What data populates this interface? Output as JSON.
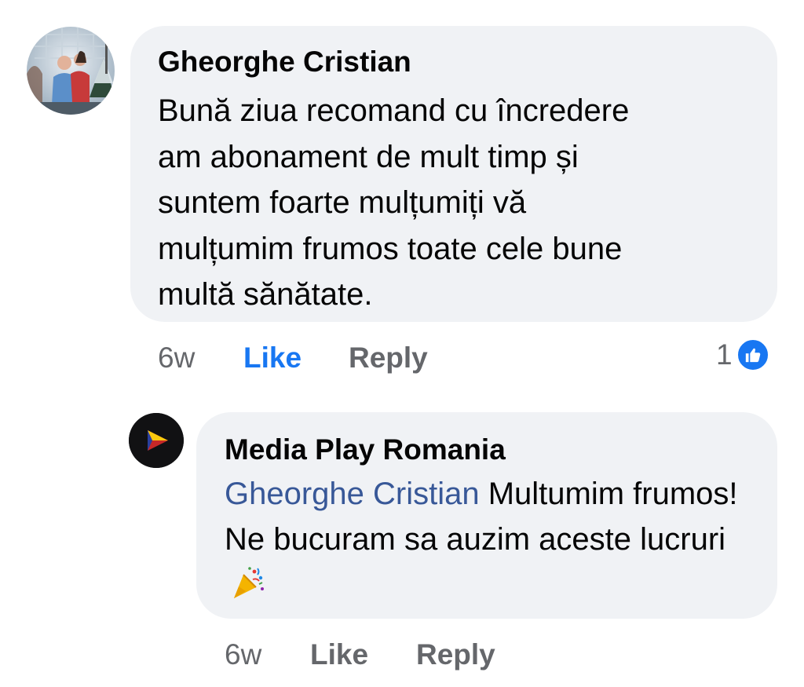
{
  "comment": {
    "author": "Gheorghe Cristian",
    "text": "Bună ziua recomand cu încredere\nam abonament de mult timp și\nsuntem foarte mulțumiți vă\nmulțumim frumos toate cele bune\nmultă sănătate.",
    "age": "6w",
    "like_label": "Like",
    "reply_label": "Reply",
    "reaction_count": "1",
    "reaction_icon": "thumbs-up-icon",
    "liked": true,
    "avatar_icon": "user-photo-avatar"
  },
  "reply": {
    "author": "Media Play Romania",
    "mention": "Gheorghe Cristian",
    "text": " Multumim frumos! Ne bucuram sa auzim aceste lucruri",
    "emoji_icon": "party-popper-icon",
    "age": "6w",
    "like_label": "Like",
    "reply_label": "Reply",
    "avatar_icon": "play-logo-avatar"
  },
  "colors": {
    "bubble": "#f0f2f5",
    "like_active": "#1877f2",
    "muted_text": "#65676b",
    "mention": "#385898"
  }
}
